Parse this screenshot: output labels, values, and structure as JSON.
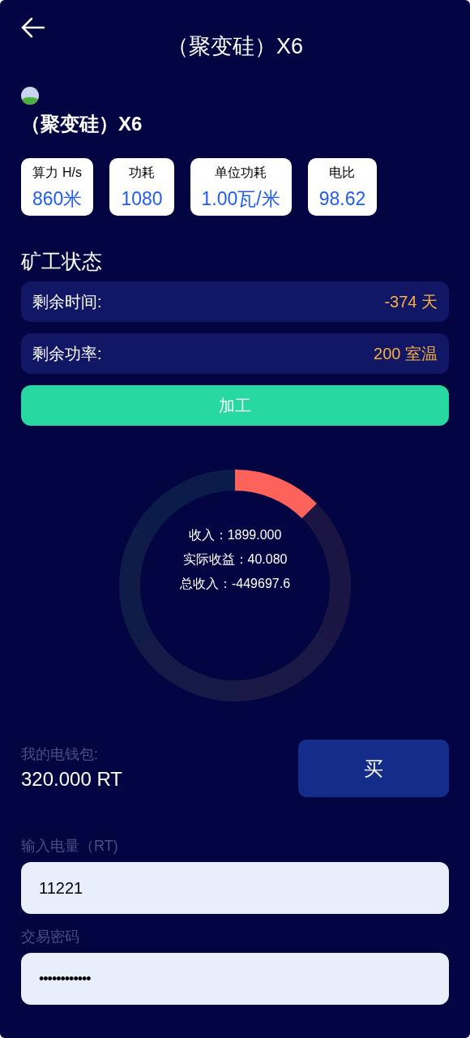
{
  "header": {
    "title": "（聚变硅）X6"
  },
  "product": {
    "name": "（聚变硅）X6"
  },
  "stats": [
    {
      "label": "算力 H/s",
      "value": "860米"
    },
    {
      "label": "功耗",
      "value": "1080"
    },
    {
      "label": "单位功耗",
      "value": "1.00瓦/米"
    },
    {
      "label": "电比",
      "value": "98.62"
    }
  ],
  "status": {
    "title": "矿工状态",
    "rows": [
      {
        "label": "剩余时间:",
        "value": "-374 天"
      },
      {
        "label": "剩余功率:",
        "value": "200 室温"
      }
    ],
    "button": "加工"
  },
  "donut": {
    "lines": [
      "收入：1899.000",
      "实际收益：40.080",
      "总收入：-449697.6"
    ]
  },
  "wallet": {
    "label": "我的电钱包:",
    "amount": "320.000 RT",
    "button": "买"
  },
  "form": {
    "fields": [
      {
        "label": "输入电量（RT)",
        "value": "11221",
        "kind": "text"
      },
      {
        "label": "交易密码",
        "value": "••••••••••••",
        "kind": "password"
      }
    ]
  }
}
